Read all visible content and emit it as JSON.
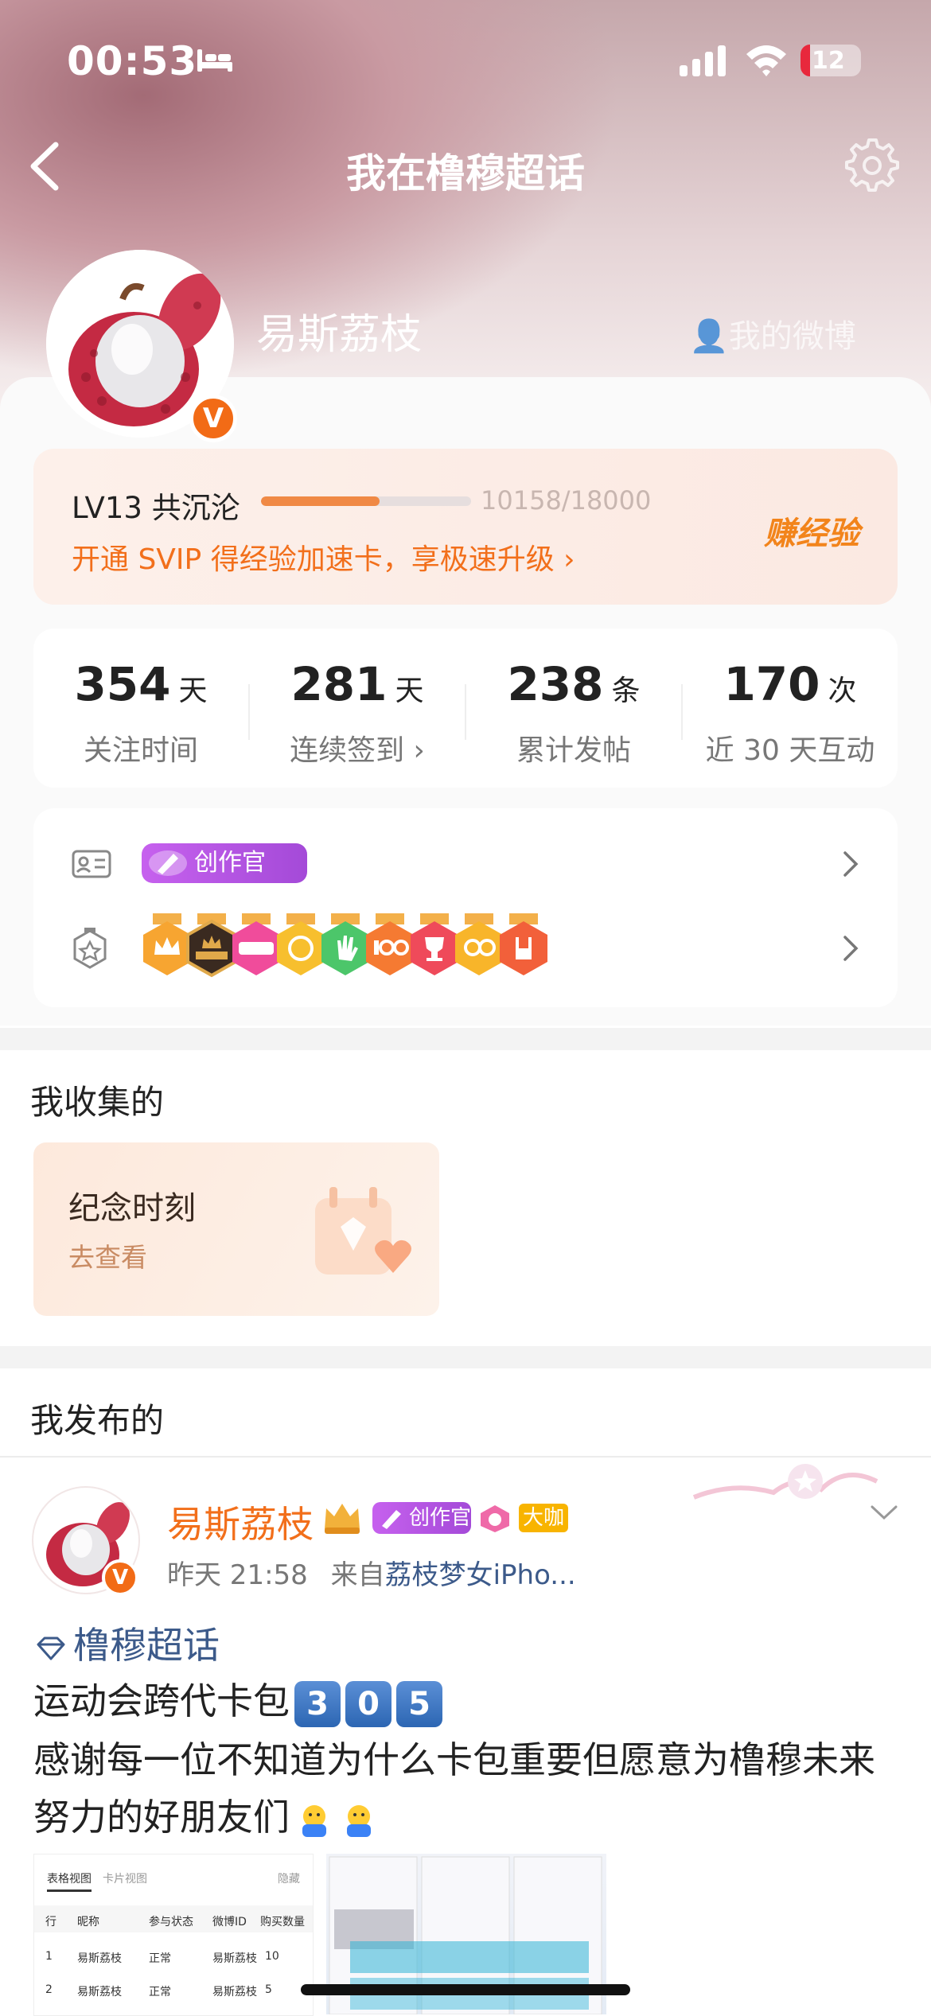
{
  "status": {
    "time": "00:53",
    "battery": "12"
  },
  "nav": {
    "title": "我在橹穆超话"
  },
  "profile": {
    "name": "易斯荔枝",
    "verified": "V",
    "my_weibo": "我的微博"
  },
  "level": {
    "label": "LV13 共沉沦",
    "progress_text": "10158/18000",
    "progress": 0.564,
    "svip_text": "开通 SVIP 得经验加速卡，享极速升级 ›",
    "earn_label": "赚经验"
  },
  "stats": [
    {
      "value": "354",
      "unit": "天",
      "label": "关注时间"
    },
    {
      "value": "281",
      "unit": "天",
      "label": "连续签到 ›"
    },
    {
      "value": "238",
      "unit": "条",
      "label": "累计发帖"
    },
    {
      "value": "170",
      "unit": "次",
      "label": "近 30 天互动"
    }
  ],
  "badges": {
    "creator_label": "创作官",
    "medals": [
      "crown",
      "super",
      "live",
      "hi",
      "hand",
      "100",
      "trophy",
      "30",
      "rock"
    ]
  },
  "colors": {
    "accent": "#f26f1b",
    "creator": "#b455e0",
    "link": "#3c5a8a"
  },
  "collected": {
    "heading": "我收集的",
    "card_title": "纪念时刻",
    "card_sub": "去查看"
  },
  "published": {
    "heading": "我发布的"
  },
  "post": {
    "author": "易斯荔枝",
    "creator_label": "创作官",
    "daka_label": "大咖",
    "time": "昨天 21:58",
    "from_prefix": "来自",
    "source": "荔枝梦女iPho...",
    "topic": "橹穆超话",
    "line1": "运动会跨代卡包",
    "keycaps": [
      "3",
      "0",
      "5"
    ],
    "line2": "感谢每一位不知道为什么卡包重要但愿意为橹穆未来努力的好朋友们"
  },
  "thumb": {
    "tabs": [
      "表格视图",
      "卡片视图",
      "隐藏"
    ],
    "headers": [
      "行",
      "昵称",
      "参与状态",
      "微博ID",
      "购买数量"
    ],
    "rows": [
      [
        "1",
        "易斯荔枝",
        "正常",
        "易斯荔枝",
        "10"
      ],
      [
        "2",
        "易斯荔枝",
        "正常",
        "易斯荔枝",
        "5"
      ]
    ]
  }
}
